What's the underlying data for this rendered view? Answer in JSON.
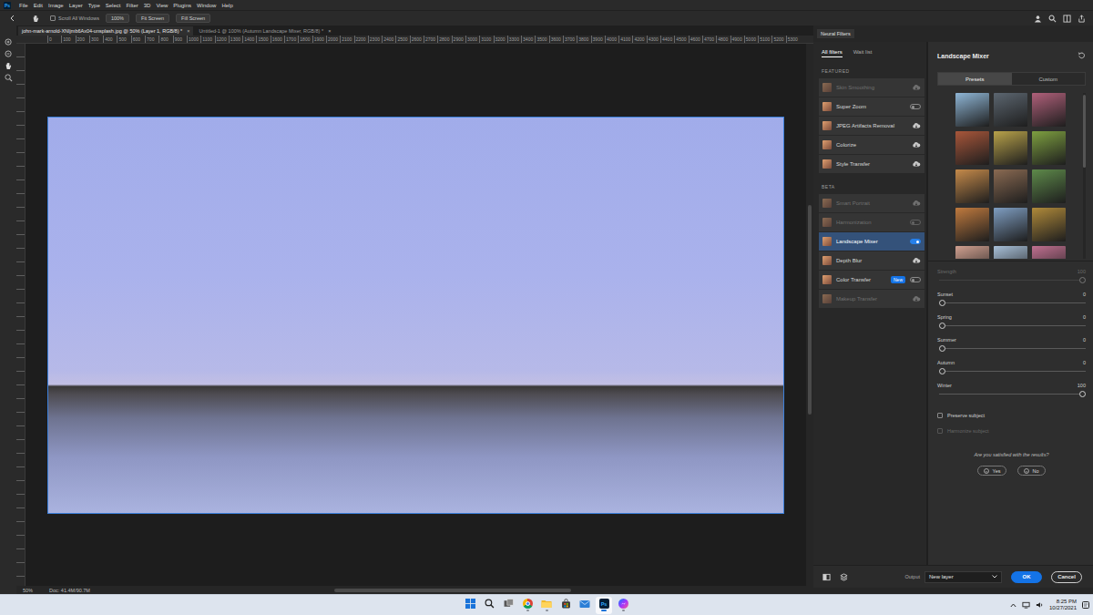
{
  "app": {
    "logo": "Ps",
    "menu": [
      "File",
      "Edit",
      "Image",
      "Layer",
      "Type",
      "Select",
      "Filter",
      "3D",
      "View",
      "Plugins",
      "Window",
      "Help"
    ]
  },
  "options_bar": {
    "scroll_all": {
      "label": "Scroll All Windows",
      "checked": false
    },
    "buttons": [
      "100%",
      "Fit Screen",
      "Fill Screen"
    ]
  },
  "document_tabs": [
    {
      "label": "john-mark-arnold-XNIjmb6Ax04-unsplash.jpg @ 50% (Layer 1, RGB/8) *",
      "selected": true,
      "close": "×"
    },
    {
      "label": "Untitled-1 @ 100% (Autumn Landscape Mixer, RGB/8) *",
      "selected": false,
      "close": "×"
    }
  ],
  "ruler": {
    "labels": [
      "0",
      "100",
      "200",
      "300",
      "400",
      "500",
      "600",
      "700",
      "800",
      "900",
      "1000",
      "1100",
      "1200",
      "1300",
      "1400",
      "1500",
      "1600",
      "1700",
      "1800",
      "1900",
      "2000",
      "2100",
      "2200",
      "2300",
      "2400",
      "2500",
      "2600",
      "2700",
      "2800",
      "2900",
      "3000",
      "3100",
      "3200",
      "3300",
      "3400",
      "3500",
      "3600",
      "3700",
      "3800",
      "3900",
      "4000",
      "4100",
      "4200",
      "4300",
      "4400",
      "4500",
      "4600",
      "4700",
      "4800",
      "4900",
      "5000",
      "5100",
      "5200",
      "5300"
    ]
  },
  "status_bar": {
    "zoom": "50%",
    "doc": "Doc: 41.4M/90.7M"
  },
  "neural_filters": {
    "title": "Neural Filters",
    "tabs": [
      {
        "label": "All filters",
        "selected": true
      },
      {
        "label": "Wait list",
        "selected": false
      }
    ],
    "groups": [
      {
        "title": "FEATURED",
        "filters": [
          {
            "name": "Skin Smoothing",
            "kind": "cloud",
            "disabled": true,
            "selected": false
          },
          {
            "name": "Super Zoom",
            "kind": "toggle",
            "on": false,
            "disabled": false,
            "selected": false
          },
          {
            "name": "JPEG Artifacts Removal",
            "kind": "cloud",
            "disabled": false,
            "selected": false
          },
          {
            "name": "Colorize",
            "kind": "cloud",
            "disabled": false,
            "selected": false
          },
          {
            "name": "Style Transfer",
            "kind": "cloud",
            "disabled": false,
            "selected": false
          }
        ]
      },
      {
        "title": "BETA",
        "filters": [
          {
            "name": "Smart Portrait",
            "kind": "cloud",
            "disabled": true,
            "selected": false
          },
          {
            "name": "Harmonization",
            "kind": "toggle",
            "on": false,
            "disabled": true,
            "selected": false
          },
          {
            "name": "Landscape Mixer",
            "kind": "toggle",
            "on": true,
            "disabled": false,
            "selected": true
          },
          {
            "name": "Depth Blur",
            "kind": "cloud",
            "disabled": false,
            "selected": false
          },
          {
            "name": "Color Transfer",
            "kind": "toggle",
            "on": false,
            "disabled": false,
            "selected": false,
            "badge": "New"
          },
          {
            "name": "Makeup Transfer",
            "kind": "cloud",
            "disabled": true,
            "selected": false
          }
        ]
      }
    ],
    "detail": {
      "title": "Landscape Mixer",
      "tabs": [
        {
          "label": "Presets",
          "selected": true
        },
        {
          "label": "Custom",
          "selected": false
        }
      ],
      "presets": [
        {
          "color": "#8fb6d6"
        },
        {
          "color": "#5c6670"
        },
        {
          "color": "#b0607a"
        },
        {
          "color": "#a8563a"
        },
        {
          "color": "#b8a24a"
        },
        {
          "color": "#7ea040"
        },
        {
          "color": "#c58a4a"
        },
        {
          "color": "#8a6a52"
        },
        {
          "color": "#5e8a4a"
        },
        {
          "color": "#c07a3e"
        },
        {
          "color": "#7f9ec2"
        },
        {
          "color": "#b08a3a"
        },
        {
          "color": "#d0a090"
        },
        {
          "color": "#a8c0d8"
        },
        {
          "color": "#c07090"
        }
      ],
      "sliders": [
        {
          "label": "Strength",
          "value": "100",
          "level": 1,
          "disabled": true
        },
        {
          "label": "Sunset",
          "value": "0",
          "level": 0,
          "disabled": false
        },
        {
          "label": "Spring",
          "value": "0",
          "level": 0,
          "disabled": false
        },
        {
          "label": "Summer",
          "value": "0",
          "level": 0,
          "disabled": false
        },
        {
          "label": "Autumn",
          "value": "0",
          "level": 0,
          "disabled": false
        },
        {
          "label": "Winter",
          "value": "100",
          "level": 1,
          "disabled": false
        }
      ],
      "checkboxes": [
        {
          "label": "Preserve subject",
          "checked": false,
          "disabled": false
        },
        {
          "label": "Harmonize subject",
          "checked": false,
          "disabled": true
        }
      ],
      "feedback": {
        "question": "Are you satisfied with the results?",
        "options": [
          "Yes",
          "No"
        ]
      }
    },
    "footer": {
      "output_label": "Output",
      "output_value": "New layer",
      "buttons": [
        {
          "label": "OK",
          "primary": true
        },
        {
          "label": "Cancel",
          "primary": false
        }
      ]
    }
  },
  "taskbar": {
    "apps": [
      {
        "kind": "start",
        "running": false,
        "selected": false
      },
      {
        "kind": "search",
        "running": false,
        "selected": false
      },
      {
        "kind": "taskview",
        "running": false,
        "selected": false
      },
      {
        "kind": "chrome",
        "running": true,
        "selected": false
      },
      {
        "kind": "explorer",
        "running": true,
        "selected": false
      },
      {
        "kind": "store",
        "running": false,
        "selected": false
      },
      {
        "kind": "mail",
        "running": false,
        "selected": false
      },
      {
        "kind": "photoshop",
        "running": true,
        "selected": true
      },
      {
        "kind": "messenger",
        "running": true,
        "selected": false
      }
    ],
    "clock": {
      "time": "8:25 PM",
      "date": "10/27/2021"
    }
  }
}
